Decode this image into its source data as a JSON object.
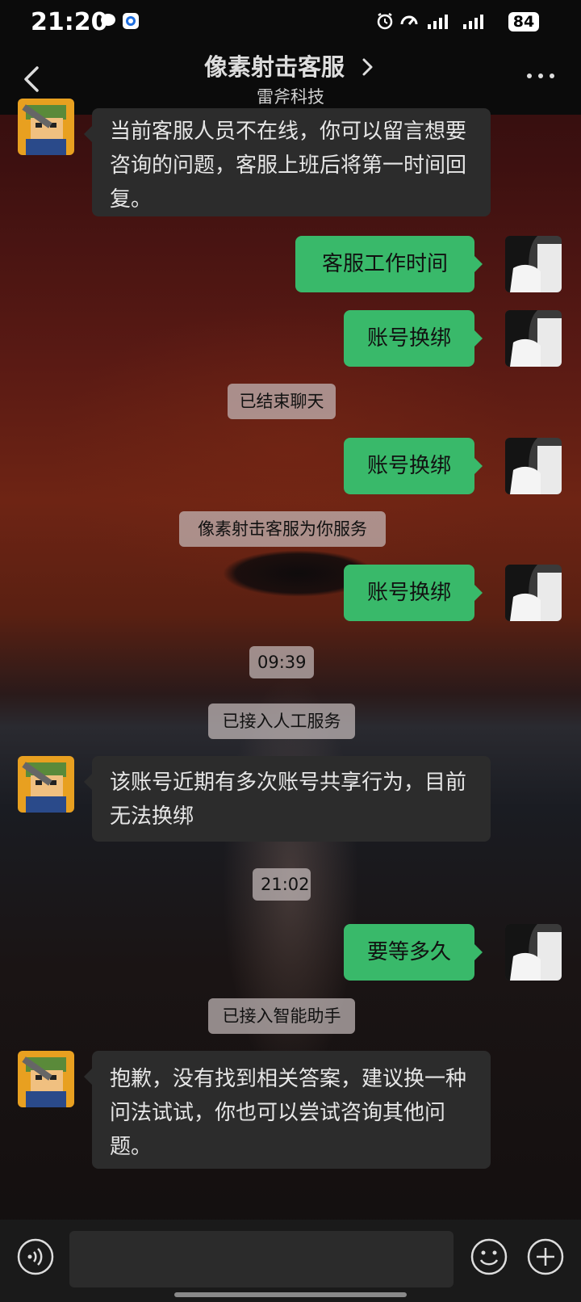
{
  "status": {
    "time": "21:20",
    "battery": "84"
  },
  "header": {
    "title": "像素射击客服",
    "subtitle": "雷斧科技"
  },
  "messages": [
    {
      "text": "当前客服人员不在线，你可以留言想要咨询的问题，客服上班后将第一时间回复。"
    },
    {
      "text": "客服工作时间"
    },
    {
      "text": "账号换绑"
    },
    {
      "text": "已结束聊天"
    },
    {
      "text": "账号换绑"
    },
    {
      "text": "像素射击客服为你服务"
    },
    {
      "text": "账号换绑"
    },
    {
      "text": "09:39"
    },
    {
      "text": "已接入人工服务"
    },
    {
      "text": "该账号近期有多次账号共享行为，目前无法换绑"
    },
    {
      "text": "21:02"
    },
    {
      "text": "要等多久"
    },
    {
      "text": "已接入智能助手"
    },
    {
      "text": "抱歉，没有找到相关答案，建议换一种问法试试，你也可以尝试咨询其他问题。"
    }
  ],
  "colors": {
    "outgoing_bubble": "#39b96a",
    "incoming_bubble": "#2c2c2c",
    "header_bg": "#0b0b0b"
  },
  "icons": [
    "chat-bubble-icon",
    "app-icon",
    "alarm-icon",
    "speed-icon",
    "signal-icon",
    "battery-icon",
    "back-icon",
    "chevron-right-icon",
    "more-icon",
    "voice-icon",
    "emoji-icon",
    "plus-icon"
  ]
}
